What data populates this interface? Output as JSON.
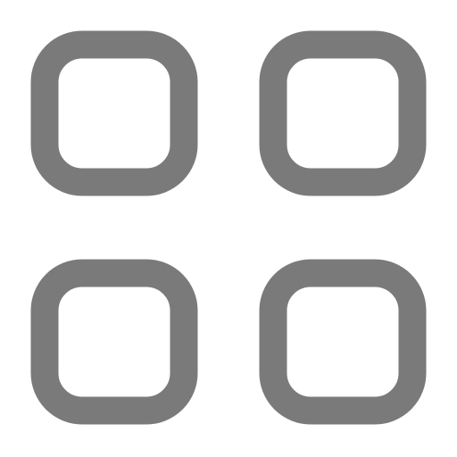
{
  "icon": {
    "name": "apps-grid-icon",
    "color": "#7a7a7a",
    "background": "#ffffff",
    "tiles": [
      {
        "name": "grid-tile-top-left"
      },
      {
        "name": "grid-tile-top-right"
      },
      {
        "name": "grid-tile-bottom-left"
      },
      {
        "name": "grid-tile-bottom-right"
      }
    ]
  }
}
